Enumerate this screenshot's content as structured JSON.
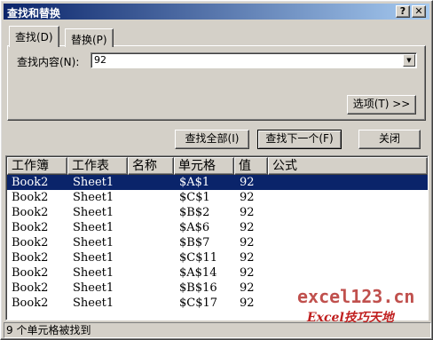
{
  "window": {
    "title": "查找和替换",
    "help_glyph": "?",
    "close_glyph": "✕"
  },
  "tabs": [
    {
      "label": "查找(D)"
    },
    {
      "label": "替换(P)"
    }
  ],
  "find": {
    "label": "查找内容(N):",
    "value": "92",
    "dropdown_glyph": "▼"
  },
  "buttons": {
    "options": "选项(T) >>",
    "find_all": "查找全部(I)",
    "find_next": "查找下一个(F)",
    "close": "关闭"
  },
  "results": {
    "columns": [
      "工作簿",
      "工作表",
      "名称",
      "单元格",
      "值",
      "公式"
    ],
    "rows": [
      [
        "Book2",
        "Sheet1",
        "",
        "$A$1",
        "92",
        ""
      ],
      [
        "Book2",
        "Sheet1",
        "",
        "$C$1",
        "92",
        ""
      ],
      [
        "Book2",
        "Sheet1",
        "",
        "$B$2",
        "92",
        ""
      ],
      [
        "Book2",
        "Sheet1",
        "",
        "$A$6",
        "92",
        ""
      ],
      [
        "Book2",
        "Sheet1",
        "",
        "$B$7",
        "92",
        ""
      ],
      [
        "Book2",
        "Sheet1",
        "",
        "$C$11",
        "92",
        ""
      ],
      [
        "Book2",
        "Sheet1",
        "",
        "$A$14",
        "92",
        ""
      ],
      [
        "Book2",
        "Sheet1",
        "",
        "$B$16",
        "92",
        ""
      ],
      [
        "Book2",
        "Sheet1",
        "",
        "$C$17",
        "92",
        ""
      ]
    ],
    "selected_row": 0
  },
  "status": "9 个单元格被找到",
  "watermark": {
    "line1": "excel123.cn",
    "line2": "Excel技巧天地"
  },
  "colors": {
    "title_bar": "#0a246a",
    "selection": "#0a246a",
    "watermark": "#c0504d"
  }
}
